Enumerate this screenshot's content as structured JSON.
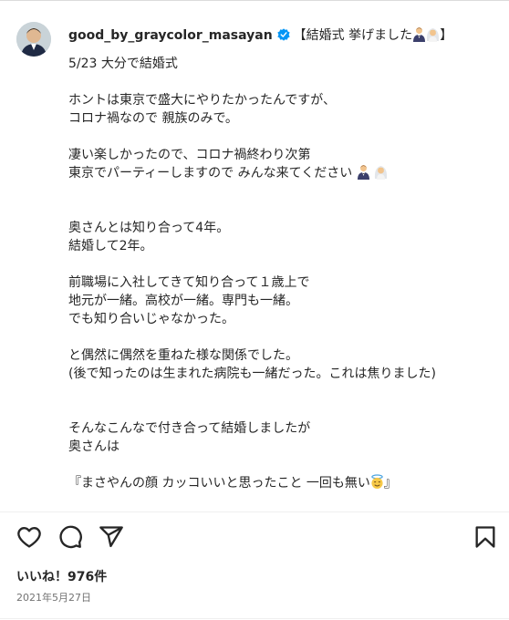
{
  "post": {
    "username": "good_by_graycolor_masayan",
    "headline_open": "【結婚式 挙げました",
    "headline_close": "】",
    "caption_lines": [
      "5/23 大分で結婚式",
      "",
      "ホントは東京で盛大にやりたかったんですが、",
      "コロナ禍なので 親族のみで。",
      "",
      "凄い楽しかったので、コロナ禍終わり次第",
      "東京でパーティーしますので みんな来てください",
      "",
      "",
      "奥さんとは知り合って4年。",
      "結婚して2年。",
      "",
      "前職場に入社してきて知り合って１歳上で",
      "地元が一緒。高校が一緒。専門も一緒。",
      "でも知り合いじゃなかった。",
      "",
      "と偶然に偶然を重ねた様な関係でした。",
      "(後で知ったのは生まれた病院も一緒だった。これは焦りました)",
      "",
      "",
      "そんなこんなで付き合って結婚しましたが",
      "奥さんは",
      "",
      "『まさやんの顔 カッコいいと思ったこと 一回も無い"
    ],
    "caption_last_tail": "』",
    "likes_text": "いいね！976件",
    "date_text": "2021年5月27日"
  },
  "icons": {
    "verified": "verified-badge-icon",
    "groom": "man-in-tuxedo-emoji",
    "bride": "bride-with-veil-emoji",
    "angel": "smiling-face-with-halo-emoji",
    "like": "heart-icon",
    "comment": "comment-bubble-icon",
    "share": "paper-plane-icon",
    "save": "bookmark-icon"
  },
  "colors": {
    "text": "#262626",
    "secondary": "#737373",
    "verified_blue": "#0095f6",
    "divider": "#efefef"
  }
}
